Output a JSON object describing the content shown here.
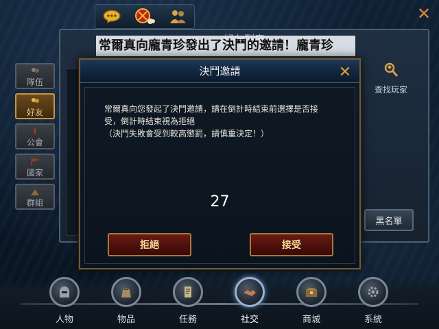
{
  "top_icons": [
    {
      "name": "chat-bubble-icon"
    },
    {
      "name": "event-emblem-icon"
    },
    {
      "name": "friends-group-icon"
    }
  ],
  "friend_panel": {
    "title": "好友列表",
    "find_player_label": "查找玩家",
    "blacklist_label": "黑名單"
  },
  "side_tabs": [
    {
      "label": "隊伍",
      "active": false
    },
    {
      "label": "好友",
      "active": true
    },
    {
      "label": "公會",
      "active": false
    },
    {
      "label": "國家",
      "active": false
    },
    {
      "label": "群組",
      "active": false
    }
  ],
  "announcement": "常爾真向龐青珍發出了決鬥的邀請！龐青珍",
  "duel_dialog": {
    "title": "決鬥邀請",
    "message_line1": "常爾真向您發起了決鬥邀請，請在倒計時結束前選擇是否接",
    "message_line2": "受，倒計時結束視為拒絕",
    "message_line3": "（決鬥失敗會受到較高懲罰，請慎重決定！）",
    "countdown": "27",
    "reject_label": "拒絕",
    "accept_label": "接受"
  },
  "bottom_nav": [
    {
      "label": "人物",
      "icon": "character-helmet-icon",
      "active": false
    },
    {
      "label": "物品",
      "icon": "item-bag-icon",
      "active": false
    },
    {
      "label": "任務",
      "icon": "quest-scroll-icon",
      "active": false
    },
    {
      "label": "社交",
      "icon": "social-handshake-icon",
      "active": true
    },
    {
      "label": "商城",
      "icon": "shop-chest-icon",
      "active": false
    },
    {
      "label": "系統",
      "icon": "system-gear-icon",
      "active": false
    }
  ],
  "colors": {
    "accent_orange": "#f09a2e",
    "button_red": "#4b0f0b",
    "button_text": "#f7d99a",
    "active_tab": "#c79442"
  }
}
